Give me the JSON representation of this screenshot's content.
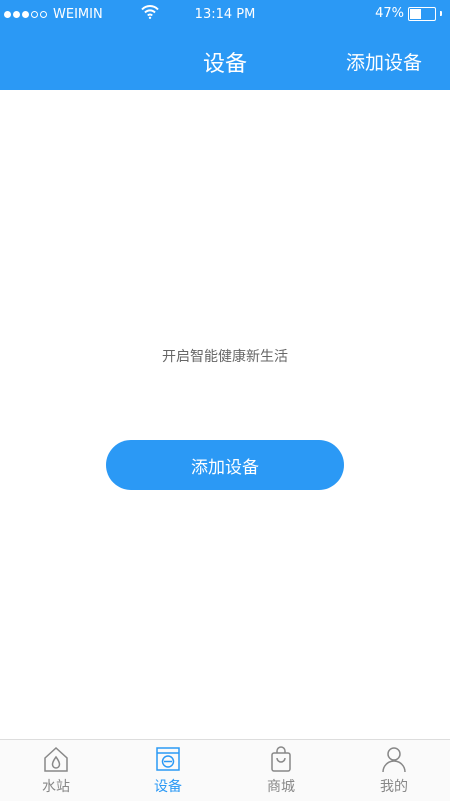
{
  "status_bar": {
    "carrier": "WEIMIN",
    "time": "13:14 PM",
    "battery": "47%"
  },
  "nav": {
    "title": "设备",
    "right_action": "添加设备"
  },
  "main": {
    "slogan": "开启智能健康新生活",
    "add_button": "添加设备"
  },
  "tabs": [
    {
      "label": "水站",
      "icon": "water-station-icon"
    },
    {
      "label": "设备",
      "icon": "device-icon",
      "active": true
    },
    {
      "label": "商城",
      "icon": "shopping-bag-icon"
    },
    {
      "label": "我的",
      "icon": "user-icon"
    }
  ],
  "colors": {
    "accent": "#2b99f5",
    "tab_inactive": "#888888"
  }
}
